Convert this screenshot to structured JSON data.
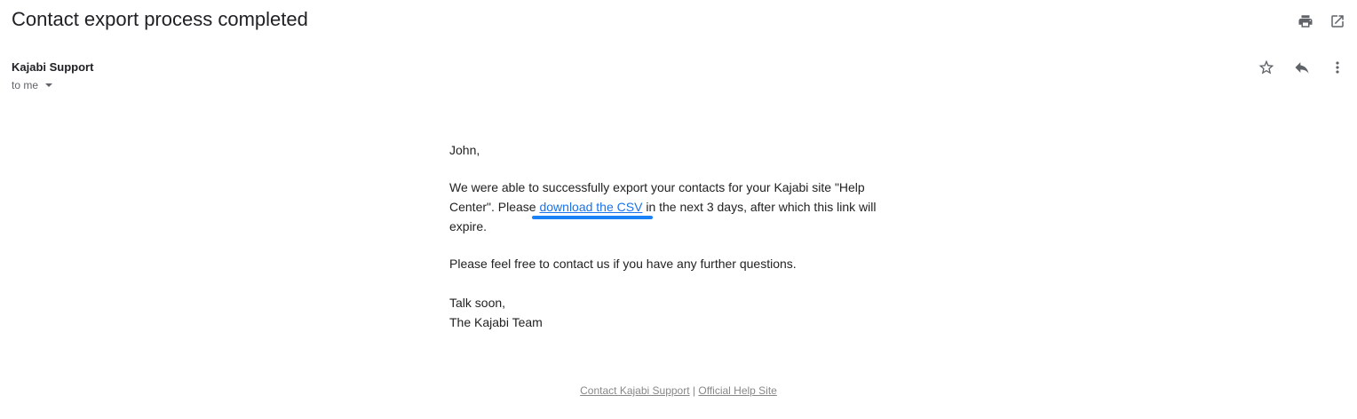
{
  "email": {
    "subject": "Contact export process completed",
    "sender": "Kajabi Support",
    "recipient": "to me"
  },
  "icons": {
    "print": "print-icon",
    "open_new_window": "open-in-new-window-icon",
    "star": "star-icon",
    "reply": "reply-icon",
    "more": "more-vert-icon"
  },
  "body": {
    "greeting": "John,",
    "para1_before": "We were able to successfully export your contacts for your Kajabi site \"Help Center\". Please ",
    "para1_link": "download the CSV",
    "para1_after": " in the next 3 days, after which this link will expire.",
    "para2": "Please feel free to contact us if you have any further questions.",
    "signoff": "Talk soon,",
    "signature": "The Kajabi Team"
  },
  "footer": {
    "link1": "Contact Kajabi Support",
    "separator": "|",
    "link2": "Official Help Site"
  },
  "colors": {
    "link": "#1a73e8",
    "highlight": "#1a82f7",
    "footer_text": "#888888"
  }
}
